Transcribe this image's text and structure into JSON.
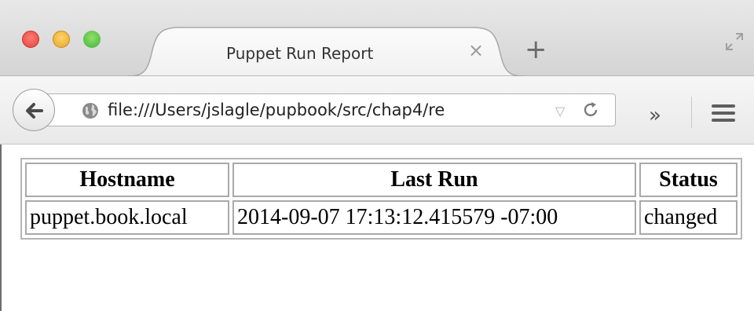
{
  "browser": {
    "tab": {
      "title": "Puppet Run Report",
      "close_glyph": "×"
    },
    "new_tab_glyph": "+",
    "url": "file:///Users/jslagle/pupbook/src/chap4/re",
    "dropdown_glyph": "▽",
    "overflow_glyph": "»",
    "icons": {
      "back": "back-arrow-icon",
      "globe": "globe-icon",
      "reload": "reload-icon",
      "menu": "hamburger-menu-icon",
      "fullscreen": "fullscreen-icon"
    },
    "colors": {
      "close": "#e0443e",
      "minimize": "#e6a52a",
      "zoom": "#42b03a"
    }
  },
  "report": {
    "headers": [
      "Hostname",
      "Last Run",
      "Status"
    ],
    "rows": [
      [
        "puppet.book.local",
        "2014-09-07 17:13:12.415579 -07:00",
        "changed"
      ]
    ]
  }
}
